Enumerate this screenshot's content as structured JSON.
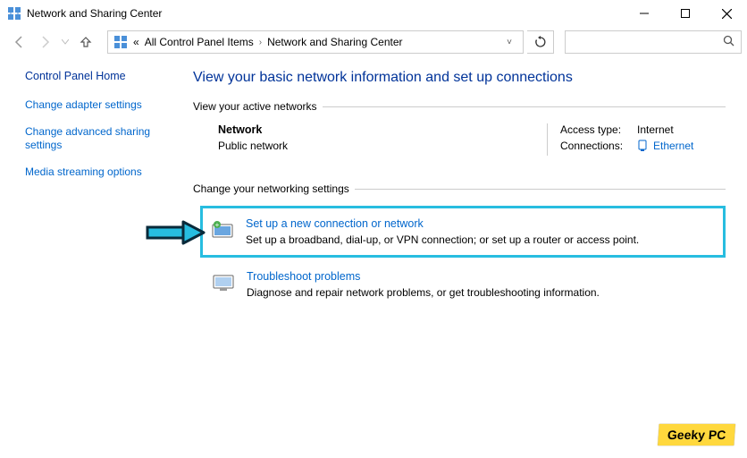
{
  "window": {
    "title": "Network and Sharing Center"
  },
  "breadcrumb": {
    "prefix": "«",
    "item1": "All Control Panel Items",
    "item2": "Network and Sharing Center"
  },
  "sidebar": {
    "home": "Control Panel Home",
    "links": [
      "Change adapter settings",
      "Change advanced sharing settings",
      "Media streaming options"
    ]
  },
  "main": {
    "title": "View your basic network information and set up connections",
    "active_head": "View your active networks",
    "network": {
      "name": "Network",
      "type": "Public network",
      "access_label": "Access type:",
      "access_value": "Internet",
      "conn_label": "Connections:",
      "conn_value": "Ethernet"
    },
    "change_head": "Change your networking settings",
    "items": [
      {
        "title": "Set up a new connection or network",
        "desc": "Set up a broadband, dial-up, or VPN connection; or set up a router or access point."
      },
      {
        "title": "Troubleshoot problems",
        "desc": "Diagnose and repair network problems, or get troubleshooting information."
      }
    ]
  },
  "watermark": "Geeky PC"
}
